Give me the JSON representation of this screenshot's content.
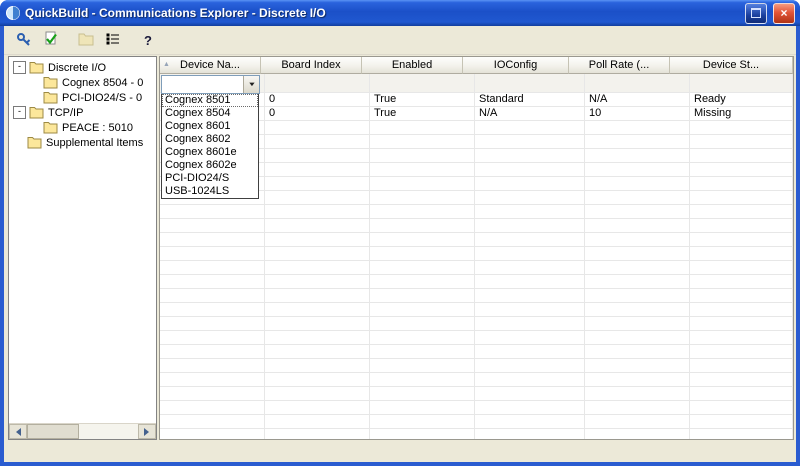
{
  "window": {
    "title": "QuickBuild - Communications Explorer - Discrete I/O"
  },
  "glyphs": {
    "sort_asc": "▲",
    "chevron_down": "▼",
    "collapse": "-",
    "help": "?",
    "close": "×"
  },
  "toolbar": {
    "buttons": [
      {
        "id": "wizard",
        "icon": "key-icon",
        "disabled": false
      },
      {
        "id": "verify",
        "icon": "check-document-icon",
        "disabled": false
      },
      {
        "id": "open",
        "icon": "folder-icon",
        "disabled": true
      },
      {
        "id": "device-list",
        "icon": "details-list-icon",
        "disabled": false
      },
      {
        "id": "help",
        "icon": "help-icon",
        "disabled": false
      }
    ]
  },
  "tree": {
    "items": [
      {
        "label": "Discrete I/O",
        "level": 0,
        "expander": "minus",
        "icon": "folder-icon"
      },
      {
        "label": "Cognex 8504 - 0",
        "level": 1,
        "expander": "none",
        "icon": "folder-icon"
      },
      {
        "label": "PCI-DIO24/S - 0",
        "level": 1,
        "expander": "none",
        "icon": "folder-icon"
      },
      {
        "label": "TCP/IP",
        "level": 0,
        "expander": "minus",
        "icon": "folder-icon"
      },
      {
        "label": "PEACE : 5010",
        "level": 1,
        "expander": "none",
        "icon": "folder-icon"
      },
      {
        "label": "Supplemental Items",
        "level": 0,
        "expander": "none",
        "icon": "folder-icon"
      }
    ]
  },
  "grid": {
    "columns": [
      "Device Na...",
      "Board Index",
      "Enabled",
      "IOConfig",
      "Poll Rate (...",
      "Device St..."
    ],
    "rows": [
      [
        "",
        "0",
        "True",
        "Standard",
        "N/A",
        "Ready"
      ],
      [
        "",
        "0",
        "True",
        "N/A",
        "10",
        "Missing"
      ]
    ]
  },
  "combo": {
    "value": "",
    "options": [
      "Cognex 8501",
      "Cognex 8504",
      "Cognex 8601",
      "Cognex 8602",
      "Cognex 8601e",
      "Cognex 8602e",
      "PCI-DIO24/S",
      "USB-1024LS"
    ]
  }
}
